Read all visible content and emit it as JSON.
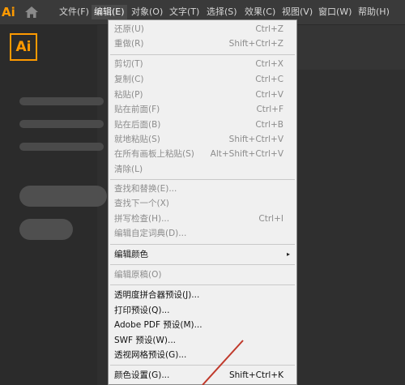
{
  "app": {
    "logo_small": "Ai",
    "logo_big": "Ai"
  },
  "menubar": {
    "items": [
      "文件(F)",
      "编辑(E)",
      "对象(O)",
      "文字(T)",
      "选择(S)",
      "效果(C)",
      "视图(V)",
      "窗口(W)",
      "帮助(H)"
    ],
    "active_index": 1
  },
  "edit_menu": {
    "items": [
      {
        "label": "还原(U)",
        "shortcut": "Ctrl+Z",
        "enabled": false
      },
      {
        "label": "重做(R)",
        "shortcut": "Shift+Ctrl+Z",
        "enabled": false
      },
      {
        "label": "剪切(T)",
        "shortcut": "Ctrl+X",
        "enabled": false
      },
      {
        "label": "复制(C)",
        "shortcut": "Ctrl+C",
        "enabled": false
      },
      {
        "label": "粘贴(P)",
        "shortcut": "Ctrl+V",
        "enabled": false
      },
      {
        "label": "贴在前面(F)",
        "shortcut": "Ctrl+F",
        "enabled": false
      },
      {
        "label": "贴在后面(B)",
        "shortcut": "Ctrl+B",
        "enabled": false
      },
      {
        "label": "就地粘贴(S)",
        "shortcut": "Shift+Ctrl+V",
        "enabled": false
      },
      {
        "label": "在所有画板上粘贴(S)",
        "shortcut": "Alt+Shift+Ctrl+V",
        "enabled": false
      },
      {
        "label": "清除(L)",
        "shortcut": "",
        "enabled": false
      },
      {
        "label": "查找和替换(E)...",
        "shortcut": "",
        "enabled": false
      },
      {
        "label": "查找下一个(X)",
        "shortcut": "",
        "enabled": false
      },
      {
        "label": "拼写检查(H)...",
        "shortcut": "Ctrl+I",
        "enabled": false
      },
      {
        "label": "编辑自定词典(D)...",
        "shortcut": "",
        "enabled": false
      },
      {
        "label": "编辑颜色",
        "shortcut": "",
        "enabled": true,
        "submenu": true
      },
      {
        "label": "编辑原稿(O)",
        "shortcut": "",
        "enabled": false
      },
      {
        "label": "透明度拼合器预设(J)...",
        "shortcut": "",
        "enabled": true
      },
      {
        "label": "打印预设(Q)...",
        "shortcut": "",
        "enabled": true
      },
      {
        "label": "Adobe PDF 预设(M)...",
        "shortcut": "",
        "enabled": true
      },
      {
        "label": "SWF 预设(W)...",
        "shortcut": "",
        "enabled": true
      },
      {
        "label": "透视网格预设(G)...",
        "shortcut": "",
        "enabled": true
      },
      {
        "label": "颜色设置(G)...",
        "shortcut": "Shift+Ctrl+K",
        "enabled": true
      }
    ],
    "submenu_arrow": "▸"
  },
  "colors": {
    "annotation": "#c0392b",
    "logo": "#ff9a00"
  }
}
